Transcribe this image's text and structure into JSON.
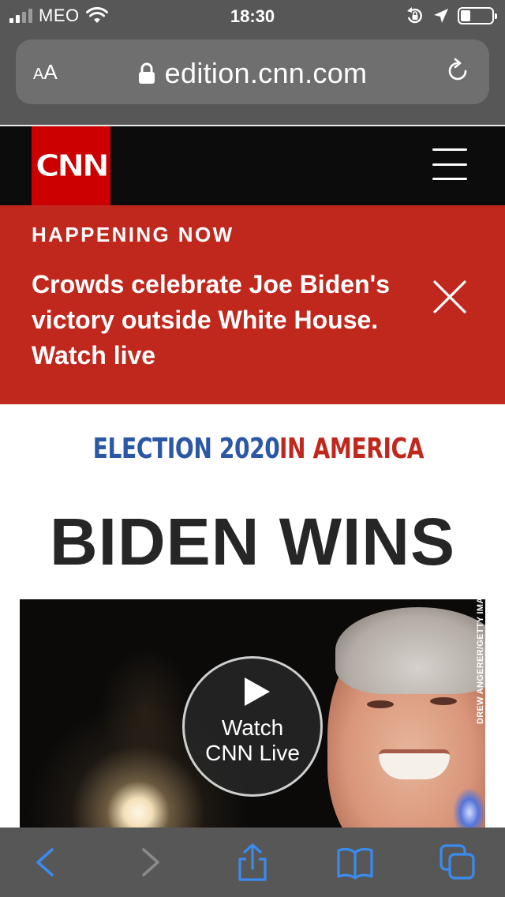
{
  "status_bar": {
    "carrier": "MEO",
    "time": "18:30",
    "signal_bars": 4,
    "signal_active": 2,
    "battery_level": 0.25
  },
  "browser": {
    "text_size_label_small": "A",
    "text_size_label_large": "A",
    "url": "edition.cnn.com",
    "icons": {
      "lock": "lock-icon",
      "reload": "reload-icon",
      "back": "back-arrow-icon",
      "forward": "forward-arrow-icon",
      "share": "share-icon",
      "bookmarks": "book-icon",
      "tabs": "tabs-icon"
    }
  },
  "site": {
    "logo_text": "CNN",
    "menu_icon": "hamburger-menu-icon",
    "colors": {
      "brand_red": "#cc0000",
      "banner_red": "#c0281e",
      "election_blue": "#2a57a6"
    }
  },
  "banner": {
    "label": "HAPPENING NOW",
    "text": "Crowds celebrate Joe Biden's victory outside White House. Watch live",
    "close_icon": "close-icon"
  },
  "headline": {
    "kicker_part1": "ELECTION 2020",
    "kicker_part2": "IN AMERICA",
    "title": "BIDEN WINS"
  },
  "video": {
    "photo_credit": "DREW ANGERER/GETTY IMAGES",
    "play_label_line1": "Watch",
    "play_label_line2": "CNN Live"
  }
}
